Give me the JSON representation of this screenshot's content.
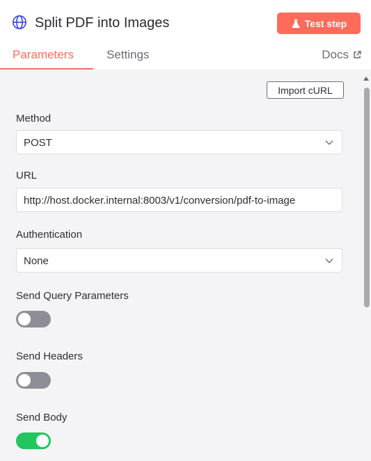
{
  "header": {
    "title": "Split PDF into Images",
    "title_icon": "globe-icon",
    "test_button_label": "Test step",
    "test_button_icon": "flask-icon"
  },
  "tabs": {
    "parameters": "Parameters",
    "settings": "Settings",
    "active": "Parameters",
    "docs": "Docs",
    "docs_icon": "external-link-icon"
  },
  "toolbar": {
    "import_curl": "Import cURL"
  },
  "form": {
    "method": {
      "label": "Method",
      "value": "POST"
    },
    "url": {
      "label": "URL",
      "value": "http://host.docker.internal:8003/v1/conversion/pdf-to-image"
    },
    "authentication": {
      "label": "Authentication",
      "value": "None"
    },
    "send_query_parameters": {
      "label": "Send Query Parameters",
      "enabled": false
    },
    "send_headers": {
      "label": "Send Headers",
      "enabled": false
    },
    "send_body": {
      "label": "Send Body",
      "enabled": true
    }
  },
  "colors": {
    "accent": "#ff6b5b",
    "toggle_on": "#22c55e",
    "toggle_off": "#8e8e96",
    "panel_background": "#f4f4f6",
    "title_icon": "#3b4ee0"
  }
}
